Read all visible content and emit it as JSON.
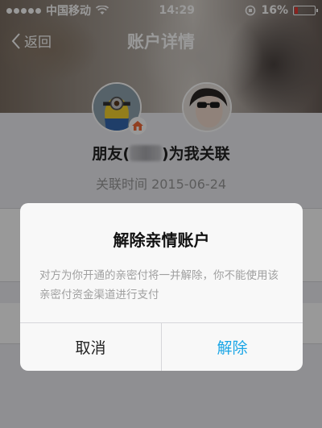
{
  "status_bar": {
    "carrier": "中国移动",
    "time": "14:29",
    "battery": "16%",
    "battery_level": 0.16
  },
  "nav": {
    "back_label": "返回",
    "title": "账户详情"
  },
  "relation": {
    "prefix": "朋友(",
    "suffix": ")为我关联",
    "time_label": "关联时间",
    "date": "2015-06-24"
  },
  "dialog": {
    "title": "解除亲情账户",
    "message": "对方为你开通的亲密付将一并解除，你不能使用该亲密付资金渠道进行支付",
    "cancel_label": "取消",
    "confirm_label": "解除"
  },
  "colors": {
    "accent": "#1aa6e6",
    "battery_low": "#e53935",
    "badge": "#f26b3a"
  }
}
